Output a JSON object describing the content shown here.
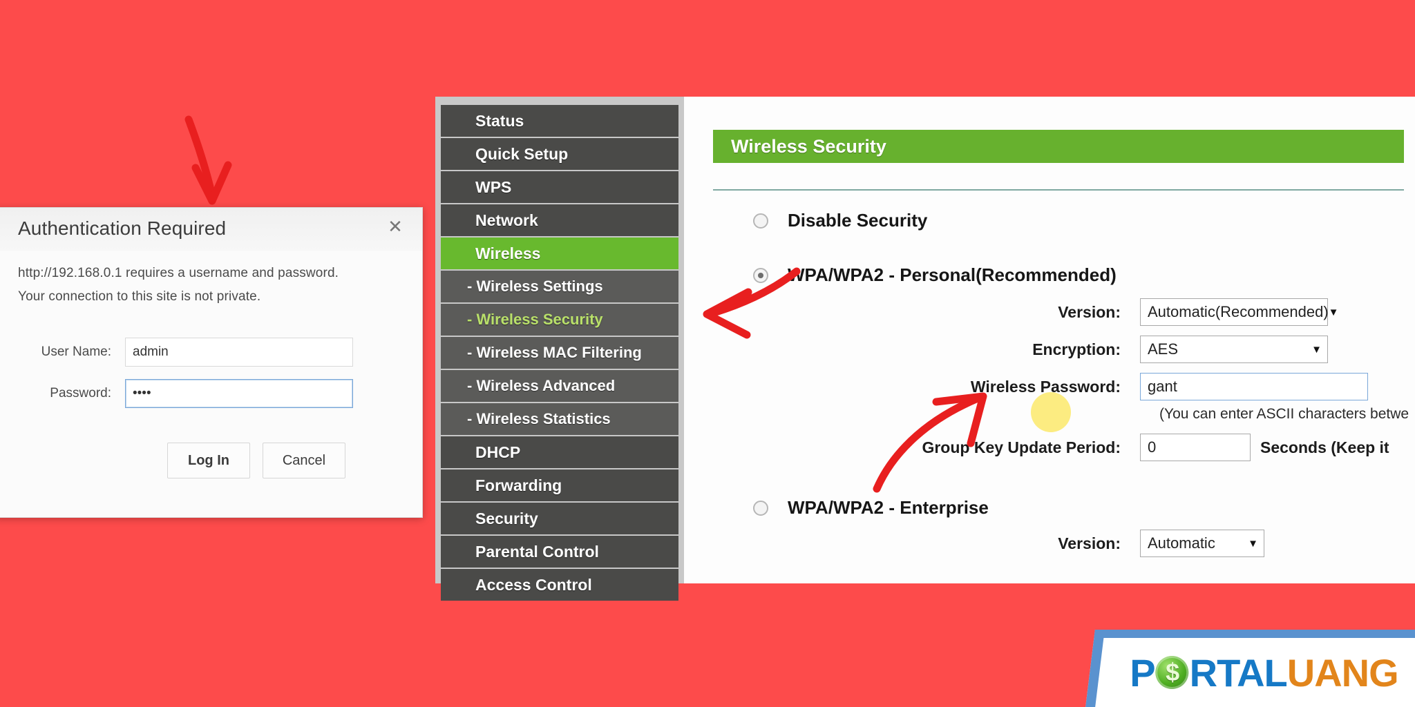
{
  "theme": {
    "background": "#fd4b4b",
    "accent_green": "#67b12e",
    "sidebar_dark": "#4a4a48",
    "sidebar_sub": "#5b5b59",
    "highlight_yellow": "#fbe96b",
    "arrow_red": "#e81f1f",
    "logo_blue": "#1679c6",
    "logo_orange": "#e2851b"
  },
  "auth_dialog": {
    "title": "Authentication Required",
    "close_icon": "close-icon",
    "message_line_1": "http://192.168.0.1 requires a username and password.",
    "message_line_2": "Your connection to this site is not private.",
    "fields": [
      {
        "label": "User Name:",
        "value": "admin",
        "placeholder": "",
        "focused": false,
        "type": "text"
      },
      {
        "label": "Password:",
        "value": "••••",
        "placeholder": "",
        "focused": true,
        "type": "password"
      }
    ],
    "buttons": {
      "login": "Log In",
      "cancel": "Cancel"
    }
  },
  "router": {
    "sidebar": {
      "items": [
        {
          "label": "Status",
          "level": "top",
          "state": "normal"
        },
        {
          "label": "Quick Setup",
          "level": "top",
          "state": "normal"
        },
        {
          "label": "WPS",
          "level": "top",
          "state": "normal"
        },
        {
          "label": "Network",
          "level": "top",
          "state": "normal"
        },
        {
          "label": "Wireless",
          "level": "top",
          "state": "active"
        },
        {
          "label": "- Wireless Settings",
          "level": "sub",
          "state": "normal"
        },
        {
          "label": "- Wireless Security",
          "level": "sub",
          "state": "subactive"
        },
        {
          "label": "- Wireless MAC Filtering",
          "level": "sub",
          "state": "normal"
        },
        {
          "label": "- Wireless Advanced",
          "level": "sub",
          "state": "normal"
        },
        {
          "label": "- Wireless Statistics",
          "level": "sub",
          "state": "normal"
        },
        {
          "label": "DHCP",
          "level": "top",
          "state": "normal"
        },
        {
          "label": "Forwarding",
          "level": "top",
          "state": "normal"
        },
        {
          "label": "Security",
          "level": "top",
          "state": "normal"
        },
        {
          "label": "Parental Control",
          "level": "top",
          "state": "normal"
        },
        {
          "label": "Access Control",
          "level": "top",
          "state": "normal"
        }
      ]
    },
    "content": {
      "page_heading": "Wireless Security",
      "options": [
        {
          "label": "Disable Security",
          "selected": false
        },
        {
          "label": "WPA/WPA2 - Personal(Recommended)",
          "selected": true
        },
        {
          "label": "WPA/WPA2 - Enterprise",
          "selected": false
        }
      ],
      "personal": {
        "version_label": "Version:",
        "version_value": "Automatic(Recommended)",
        "encryption_label": "Encryption:",
        "encryption_value": "AES",
        "password_label": "Wireless Password:",
        "password_value": "gant",
        "password_hint": "(You can enter ASCII characters betwe",
        "group_key_label": "Group Key Update Period:",
        "group_key_value": "0",
        "group_key_suffix": "Seconds (Keep it"
      },
      "enterprise": {
        "version_label": "Version:",
        "version_value": "Automatic"
      },
      "caret_icon": "chevron-down-icon"
    }
  },
  "annotations": {
    "arrow_to_dialog": "arrow-down-icon",
    "arrow_to_wireless_security": "arrow-left-icon",
    "arrow_to_password": "arrow-up-right-icon",
    "highlight": "highlight-circle"
  },
  "logo": {
    "part_1": "P",
    "coin_icon": "dollar-coin-icon",
    "part_2": "RTAL",
    "part_3": "UANG"
  }
}
